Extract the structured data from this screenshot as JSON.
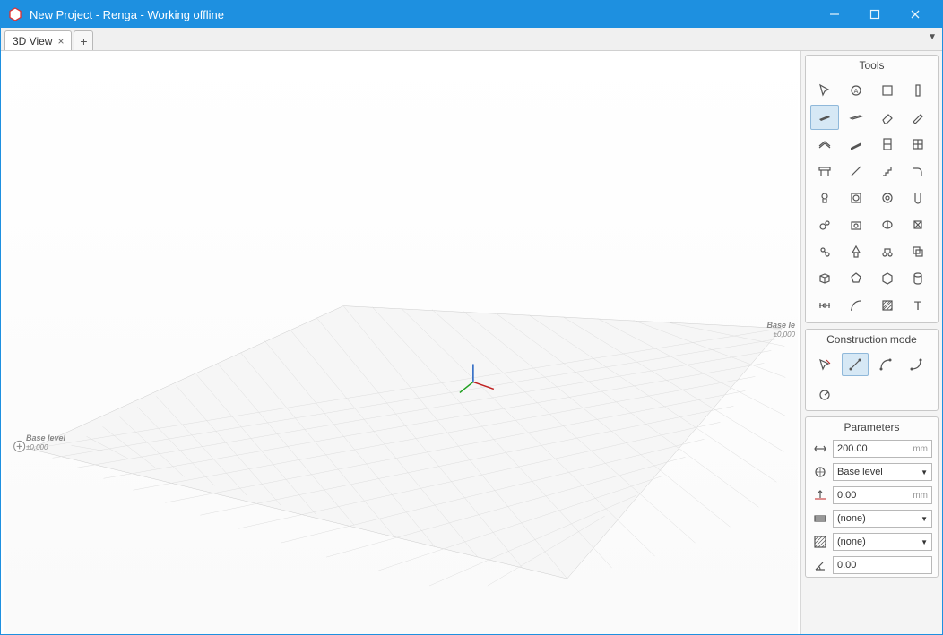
{
  "window": {
    "title": "New Project - Renga - Working offline"
  },
  "tabs": {
    "active": "3D View",
    "add": "+"
  },
  "viewport": {
    "left_label": "Base level",
    "left_sub": "±0,000",
    "right_label": "Base le",
    "right_sub": "±0,000"
  },
  "panels": {
    "tools_title": "Tools",
    "mode_title": "Construction mode",
    "params_title": "Parameters"
  },
  "params": {
    "p1_value": "200.00",
    "p1_unit": "mm",
    "p2_value": "Base level",
    "p3_value": "0.00",
    "p3_unit": "mm",
    "p4_value": "(none)",
    "p5_value": "(none)",
    "p6_value": "0.00"
  }
}
